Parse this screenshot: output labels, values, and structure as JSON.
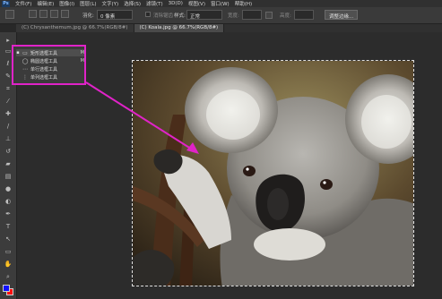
{
  "app": {
    "logo": "Ps"
  },
  "menubar": {
    "items": [
      "文件(F)",
      "编辑(E)",
      "图像(I)",
      "图层(L)",
      "文字(Y)",
      "选择(S)",
      "滤镜(T)",
      "3D(D)",
      "视图(V)",
      "窗口(W)",
      "帮助(H)"
    ]
  },
  "options_bar": {
    "feather_label": "羽化:",
    "feather_value": "0 像素",
    "antialias_label": "消除锯齿",
    "style_label": "样式:",
    "style_value": "正常",
    "width_label": "宽度:",
    "height_label": "高度:",
    "refine_button": "调整边缘..."
  },
  "tabs": [
    {
      "label": "(C) Chrysanthemum.jpg @ 66.7%(RGB/8#)",
      "active": false
    },
    {
      "label": "(C) Koala.jpg @ 66.7%(RGB/8#)",
      "active": true
    }
  ],
  "flyout": {
    "items": [
      {
        "icon": "rect-marquee-icon",
        "glyph": "▭",
        "label": "矩形选框工具",
        "key": "M",
        "selected": true
      },
      {
        "icon": "ellipse-marquee-icon",
        "glyph": "◯",
        "label": "椭圆选框工具",
        "key": "M",
        "selected": false
      },
      {
        "icon": "single-row-marquee-icon",
        "glyph": "⋯",
        "label": "单行选框工具",
        "key": "",
        "selected": false
      },
      {
        "icon": "single-column-marquee-icon",
        "glyph": "⋮",
        "label": "单列选框工具",
        "key": "",
        "selected": false
      }
    ]
  },
  "colors": {
    "accent_highlight": "#e023c8",
    "foreground_color": "#1010ff",
    "background_color": "#ff1010"
  }
}
